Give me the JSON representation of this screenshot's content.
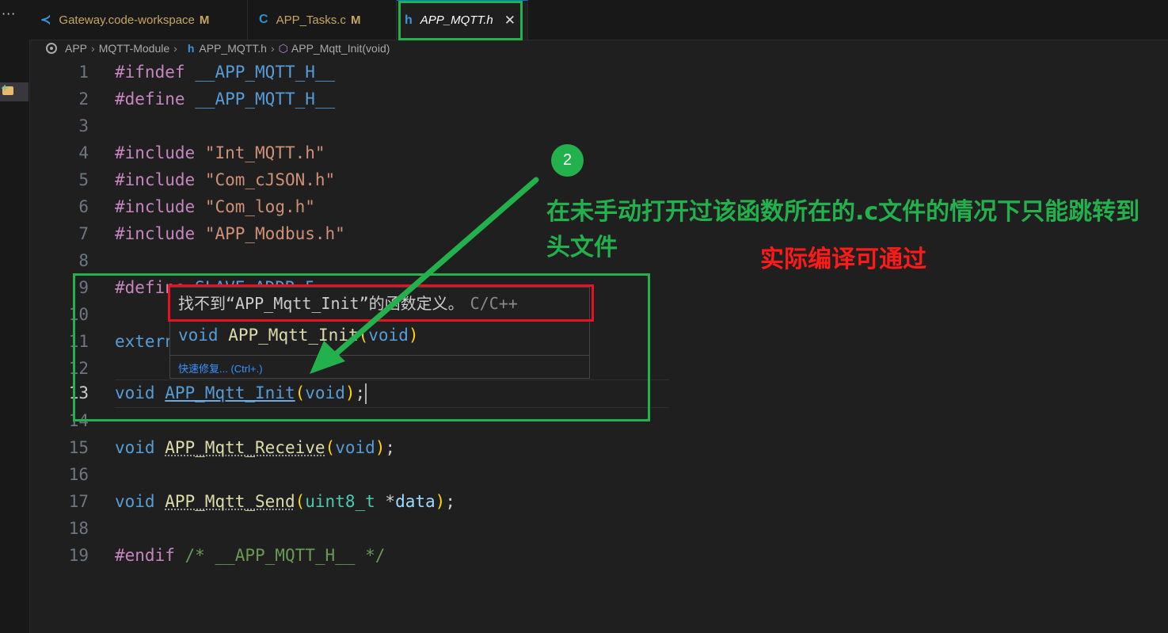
{
  "tabs": [
    {
      "label": "Gateway.code-workspace",
      "modified": "M",
      "icon": "vscode-icon"
    },
    {
      "label": "APP_Tasks.c",
      "modified": "M",
      "icon": "c-file-icon"
    },
    {
      "label": "APP_MQTT.h",
      "close": "✕",
      "icon": "h-file-icon"
    }
  ],
  "breadcrumb": [
    "APP",
    "MQTT-Module",
    "APP_MQTT.h",
    "APP_Mqtt_Init(void)"
  ],
  "line_numbers": [
    "1",
    "2",
    "3",
    "4",
    "5",
    "6",
    "7",
    "8",
    "9",
    "10",
    "11",
    "12",
    "13",
    "14",
    "15",
    "16",
    "17",
    "18",
    "19"
  ],
  "code": {
    "l1_dir": "#ifndef",
    "l1_macro": "__APP_MQTT_H__",
    "l2_dir": "#define",
    "l2_macro": "__APP_MQTT_H__",
    "l4_dir": "#include",
    "l4_str": "\"Int_MQTT.h\"",
    "l5_dir": "#include",
    "l5_str": "\"Com_cJSON.h\"",
    "l6_dir": "#include",
    "l6_str": "\"Com_log.h\"",
    "l7_dir": "#include",
    "l7_str": "\"APP_Modbus.h\"",
    "l9_dir": "#define",
    "l9_rest": "SLAVE_ADDR 5",
    "l11_kw": "extern",
    "l13_void": "void",
    "l13_fn": "APP_Mqtt_Init",
    "l13_open": "(",
    "l13_arg": "void",
    "l13_close": ")",
    "l13_semi": ";",
    "l15_void": "void",
    "l15_fn": "APP_Mqtt_Receive",
    "l15_open": "(",
    "l15_arg": "void",
    "l15_close": ")",
    "l15_semi": ";",
    "l17_void": "void",
    "l17_fn": "APP_Mqtt_Send",
    "l17_open": "(",
    "l17_ty": "uint8_t",
    "l17_ptr": " *",
    "l17_var": "data",
    "l17_close": ")",
    "l17_semi": ";",
    "l19_dir": "#endif",
    "l19_cm": "/* __APP_MQTT_H__ */"
  },
  "hover": {
    "error": "找不到“APP_Mqtt_Init”的函数定义。",
    "source": "C/C++",
    "sig_void": "void",
    "sig_fn": "APP_Mqtt_Init",
    "sig_open": "(",
    "sig_arg": "void",
    "sig_close": ")",
    "quickfix": "快速修复... (Ctrl+.)"
  },
  "annotations": {
    "badge": "2",
    "green_text": "在未手动打开过该函数所在的.c文件的情况下只能跳转到头文件",
    "red_text": "实际编译可通过",
    "green": "#22b14c",
    "red": "#ff1a1a"
  }
}
